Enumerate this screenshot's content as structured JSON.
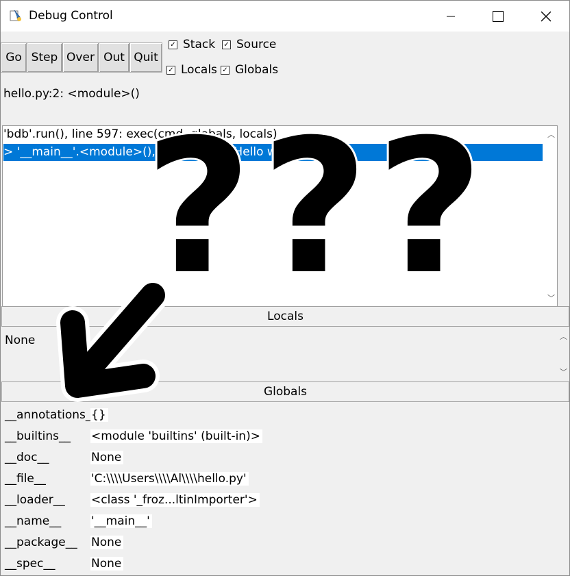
{
  "window": {
    "title": "Debug Control"
  },
  "toolbar": {
    "buttons": [
      "Go",
      "Step",
      "Over",
      "Out",
      "Quit"
    ],
    "checkboxes": [
      {
        "label": "Stack",
        "checked": true
      },
      {
        "label": "Source",
        "checked": true
      },
      {
        "label": "Locals",
        "checked": true
      },
      {
        "label": "Globals",
        "checked": true
      }
    ]
  },
  "status": "hello.py:2: <module>()",
  "stack": {
    "lines": [
      "'bdb'.run(), line 597: exec(cmd, globals, locals)",
      "> '__main__'.<module>(), line 2: print('Hello world!')"
    ]
  },
  "locals": {
    "header": "Locals",
    "value": "None"
  },
  "globals": {
    "header": "Globals",
    "rows": [
      {
        "name": "__annotations__",
        "value": "{}"
      },
      {
        "name": "__builtins__",
        "value": "<module 'builtins' (built-in)>"
      },
      {
        "name": "__doc__",
        "value": "None"
      },
      {
        "name": "__file__",
        "value": "'C:\\\\\\\\Users\\\\\\\\Al\\\\\\\\hello.py'"
      },
      {
        "name": "__loader__",
        "value": "<class '_froz...ltinImporter'>"
      },
      {
        "name": "__name__",
        "value": "'__main__'"
      },
      {
        "name": "__package__",
        "value": "None"
      },
      {
        "name": "__spec__",
        "value": "None"
      }
    ]
  },
  "overlay": {
    "question_marks": [
      "?",
      "?",
      "?"
    ]
  },
  "colors": {
    "selection": "#0078d7",
    "titlebar": "#ffffff",
    "window": "#f0f0f0"
  }
}
